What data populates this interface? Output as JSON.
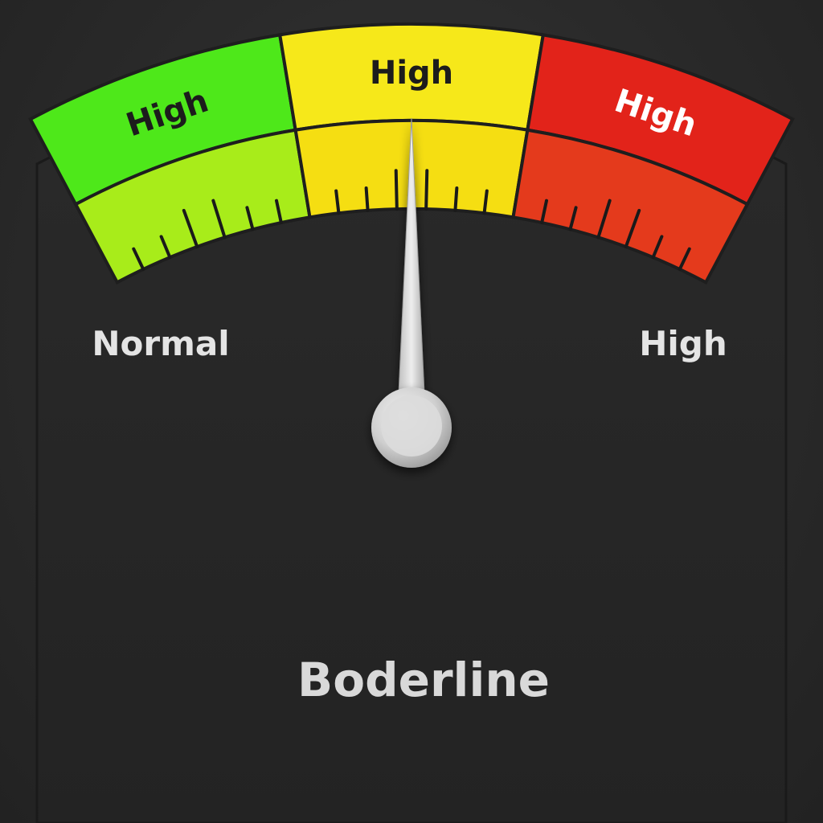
{
  "gauge": {
    "zones": [
      {
        "label": "High",
        "color_outer": "#4ee81a",
        "color_inner": "#a8ec1a",
        "text_color": "#1c1c1c"
      },
      {
        "label": "High",
        "color_outer": "#f6e81a",
        "color_inner": "#f5de12",
        "text_color": "#1c1c1c"
      },
      {
        "label": "High",
        "color_outer": "#e2231a",
        "color_inner": "#e43a1c",
        "text_color": "#ffffff"
      }
    ],
    "left_label": "Normal",
    "right_label": "High",
    "status_text": "Boderline",
    "needle_value": 0.5,
    "needle_color": "#d4d4d4",
    "panel_color": "#262626"
  }
}
